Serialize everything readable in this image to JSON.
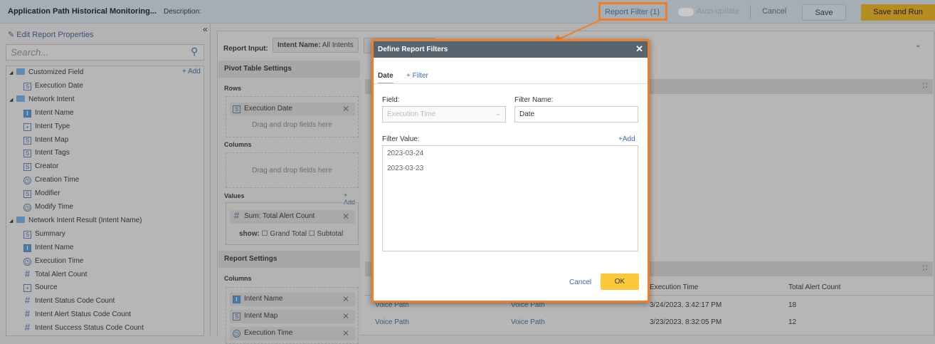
{
  "header": {
    "title": "Application Path Historical Monitoring...",
    "description_label": "Description:",
    "report_filter": "Report Filter (1)",
    "auto_update": "Auto-update",
    "cancel": "Cancel",
    "save": "Save",
    "save_and_run": "Save and Run"
  },
  "sidebar": {
    "edit_properties": "Edit Report Properties",
    "search_placeholder": "Search...",
    "add": "+ Add",
    "items": [
      {
        "label": "Customized Field",
        "type": "folder",
        "level": 0
      },
      {
        "label": "Execution Date",
        "type": "S",
        "level": 1
      },
      {
        "label": "Network Intent",
        "type": "folder",
        "level": 0
      },
      {
        "label": "Intent Name",
        "type": "I",
        "level": 1
      },
      {
        "label": "Intent Type",
        "type": "list",
        "level": 1
      },
      {
        "label": "Intent Map",
        "type": "S",
        "level": 1
      },
      {
        "label": "Intent Tags",
        "type": "S",
        "level": 1
      },
      {
        "label": "Creator",
        "type": "S",
        "level": 1
      },
      {
        "label": "Creation Time",
        "type": "clock",
        "level": 1
      },
      {
        "label": "Modifier",
        "type": "S",
        "level": 1
      },
      {
        "label": "Modify Time",
        "type": "clock",
        "level": 1
      },
      {
        "label": "Network Intent Result (Intent Name)",
        "type": "folder",
        "level": 0
      },
      {
        "label": "Summary",
        "type": "S",
        "level": 1
      },
      {
        "label": "Intent Name",
        "type": "I",
        "level": 1
      },
      {
        "label": "Execution Time",
        "type": "clock",
        "level": 1
      },
      {
        "label": "Total Alert Count",
        "type": "hash",
        "level": 1
      },
      {
        "label": "Source",
        "type": "list",
        "level": 1
      },
      {
        "label": "Intent Status Code Count",
        "type": "hash",
        "level": 1
      },
      {
        "label": "Intent Alert Status Code Count",
        "type": "hash",
        "level": 1
      },
      {
        "label": "Intent Success Status Code Count",
        "type": "hash",
        "level": 1
      }
    ]
  },
  "main": {
    "report_input_label": "Report Input:",
    "intent_chip_key": "Intent Name:",
    "intent_chip_value": "All Intents",
    "pivot": {
      "title": "Pivot Table Settings",
      "rows_label": "Rows",
      "rows_field": "Execution Date",
      "drop_hint": "Drag and drop fields here",
      "columns_label": "Columns",
      "values_label": "Values",
      "values_add": "+ Add",
      "values_field": "Sum: Total Alert Count",
      "show_label": "show:",
      "grand_total": "Grand Total",
      "subtotal": "Subtotal"
    },
    "report_settings": {
      "title": "Report Settings",
      "columns_label": "Columns",
      "fields": [
        "Intent Name",
        "Intent Map",
        "Execution Time"
      ]
    },
    "table": {
      "headers": [
        "Execution Time",
        "Total Alert Count"
      ],
      "rows": [
        [
          "Voice Path",
          "Voice Path",
          "3/24/2023, 3:42:17 PM",
          "18"
        ],
        [
          "Voice Path",
          "Voice Path",
          "3/23/2023, 8:32:05 PM",
          "12"
        ]
      ]
    }
  },
  "modal": {
    "title": "Define Report Filters",
    "tab_date": "Date",
    "tab_add": "+ Filter",
    "field_label": "Field:",
    "field_value": "Execution Time",
    "filter_name_label": "Filter Name:",
    "filter_name_value": "Date",
    "filter_value_label": "Filter Value:",
    "add": "+Add",
    "values": [
      "2023-03-24",
      "2023-03-23"
    ],
    "cancel": "Cancel",
    "ok": "OK"
  },
  "colors": {
    "highlight": "#f07e26",
    "ok": "#fcc93a",
    "modal_header": "#566470"
  }
}
